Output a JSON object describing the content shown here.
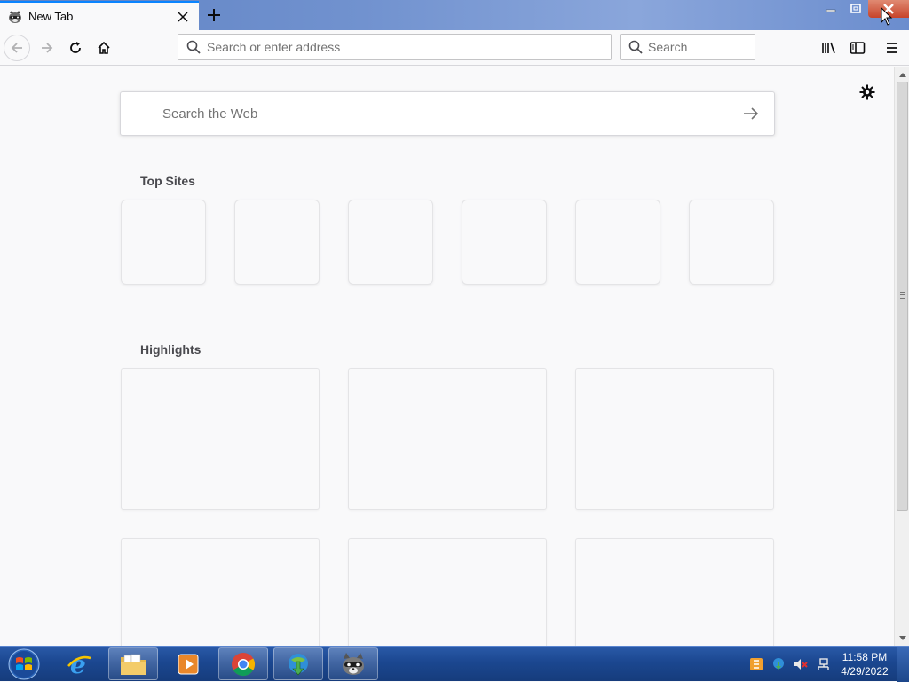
{
  "browser": {
    "tab": {
      "title": "New Tab"
    },
    "urlbar": {
      "placeholder": "Search or enter address"
    },
    "searchbar": {
      "placeholder": "Search"
    }
  },
  "newtab": {
    "web_search_placeholder": "Search the Web",
    "top_sites_title": "Top Sites",
    "highlights_title": "Highlights"
  },
  "taskbar": {
    "time": "11:58 PM",
    "date": "4/29/2022"
  },
  "colors": {
    "accent": "#0a84ff",
    "taskbar": "#1b4790",
    "close_button": "#c7432a"
  }
}
